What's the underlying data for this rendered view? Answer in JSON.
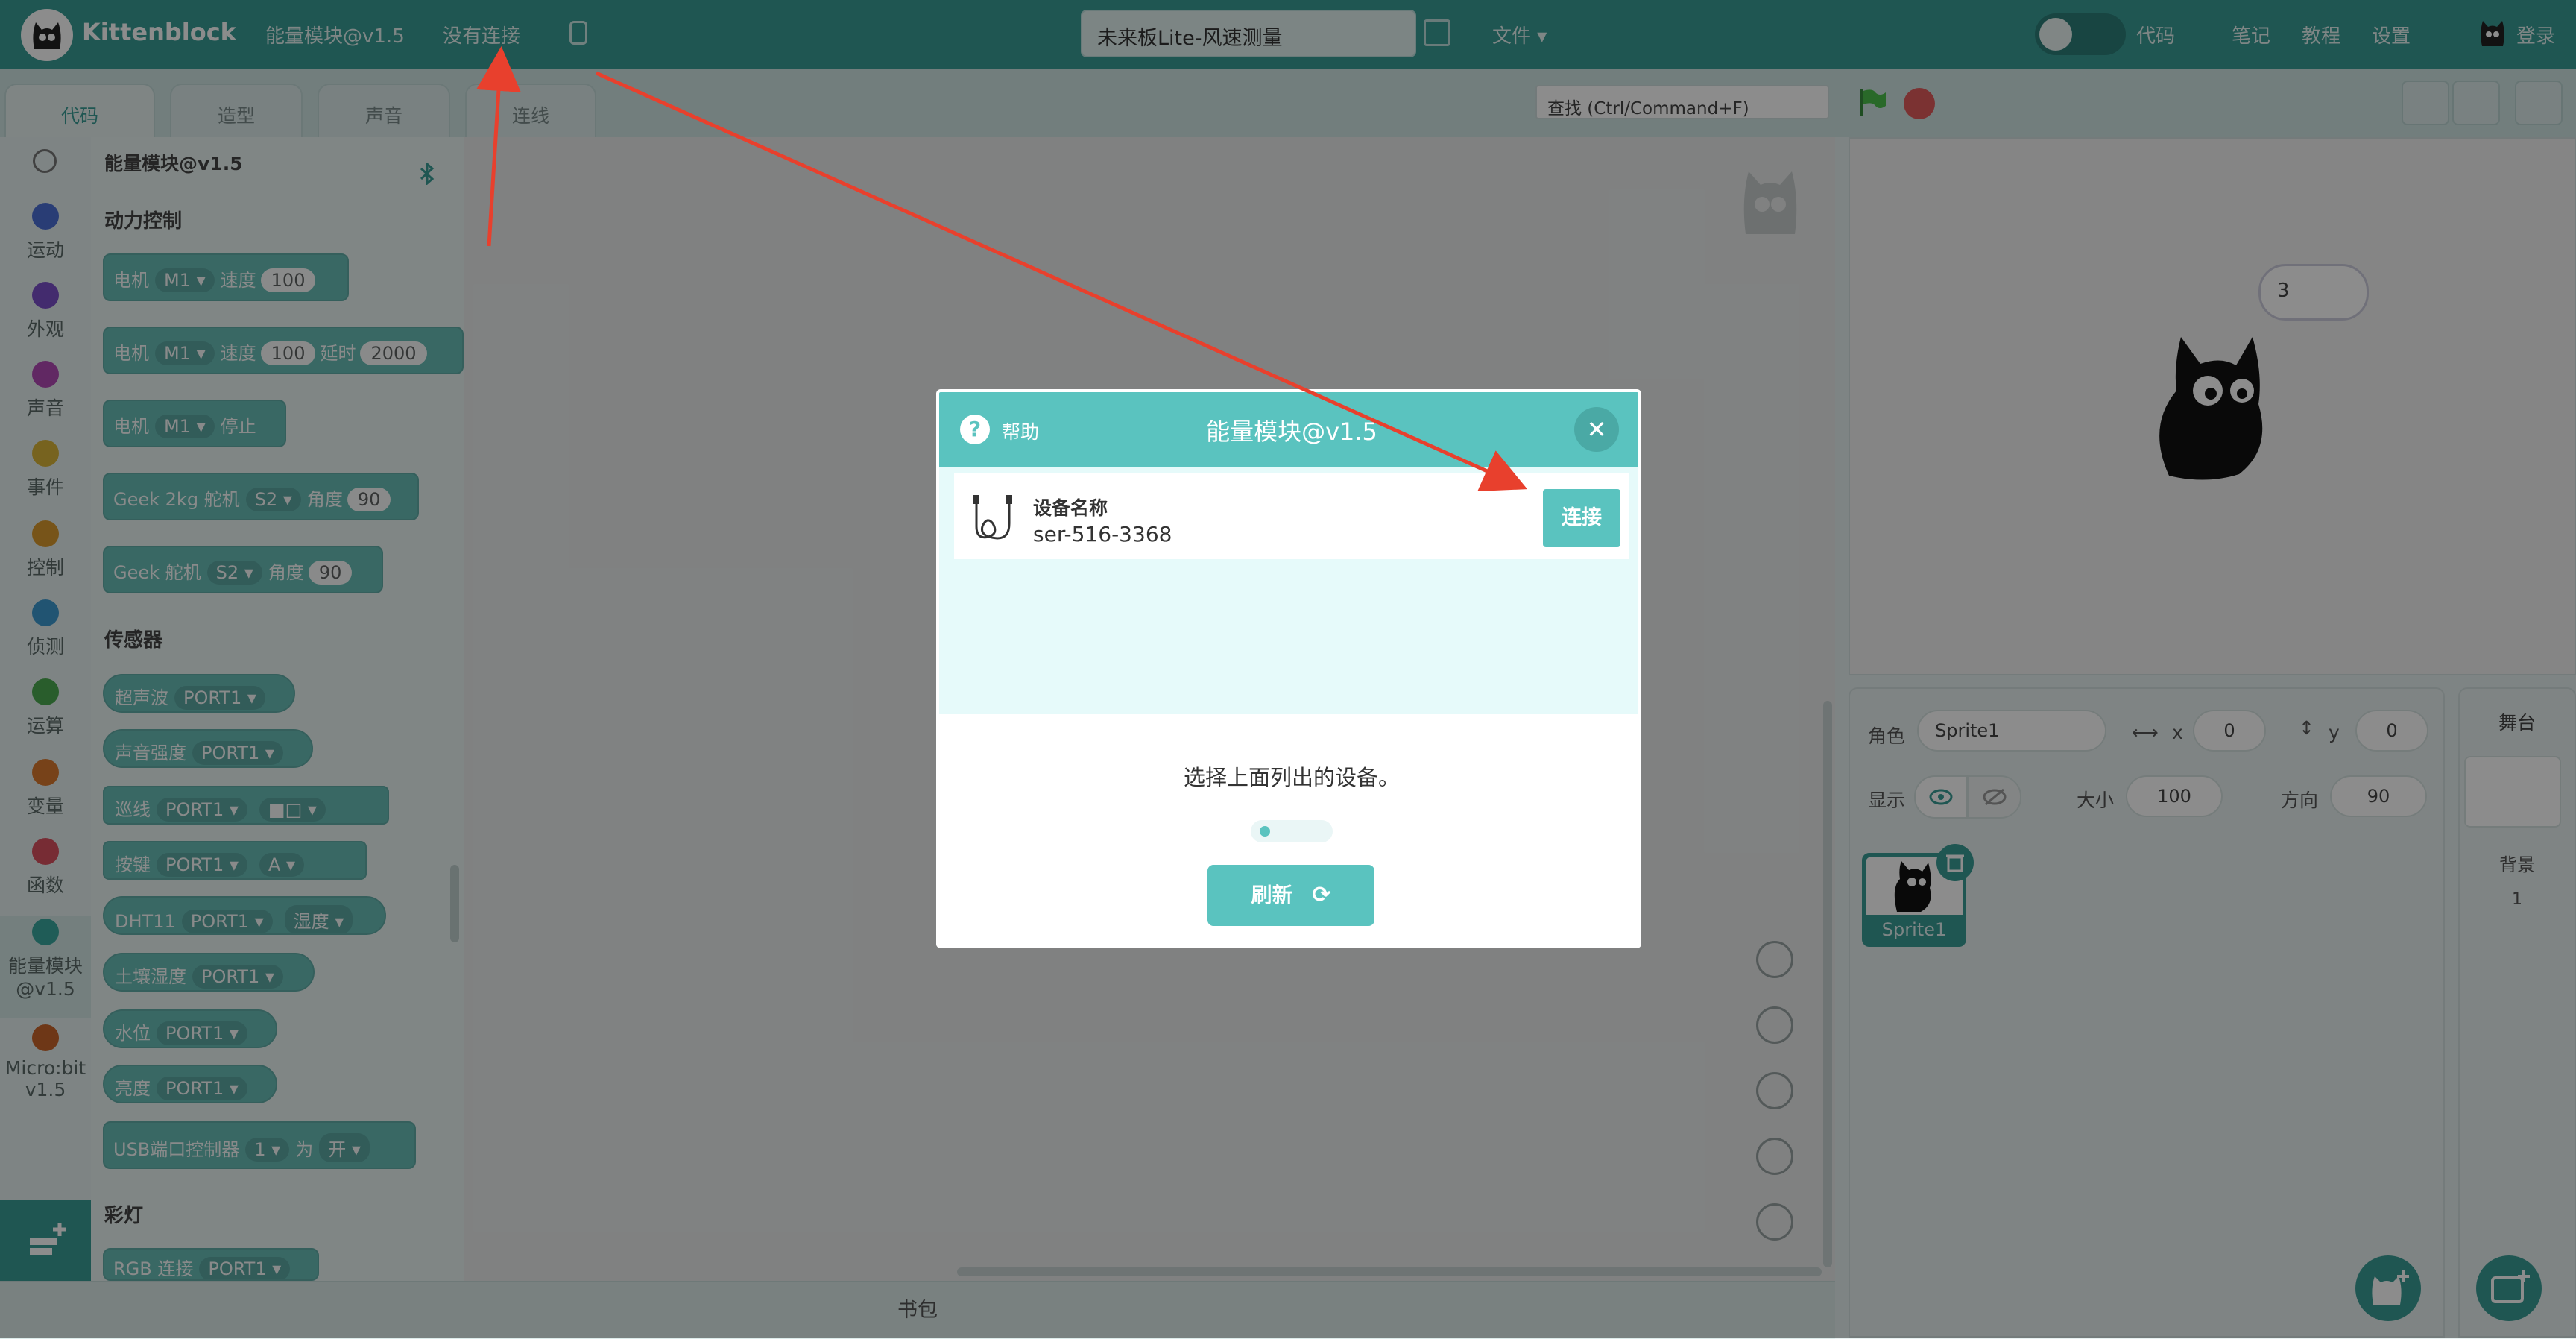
{
  "app": {
    "logo_text": "Kittenblock"
  },
  "menubar": {
    "extension_label": "能量模块@v1.5",
    "connection_status": "没有连接",
    "project_name": "未来板Lite-风速测量",
    "file_menu": "文件 ▾",
    "code_toggle_label": "代码",
    "notes": "笔记",
    "tutorial": "教程",
    "settings": "设置",
    "login": "登录"
  },
  "tabs": [
    {
      "label": "代码"
    },
    {
      "label": "造型"
    },
    {
      "label": "声音"
    },
    {
      "label": "连线"
    }
  ],
  "find": {
    "placeholder": "查找 (Ctrl/Command+F)"
  },
  "categories": [
    {
      "label": "运动",
      "color": "#4c6fd6"
    },
    {
      "label": "外观",
      "color": "#7a4fc8"
    },
    {
      "label": "声音",
      "color": "#b14ab4"
    },
    {
      "label": "事件",
      "color": "#d9b43a"
    },
    {
      "label": "控制",
      "color": "#d99a2e"
    },
    {
      "label": "侦测",
      "color": "#3c9ad0"
    },
    {
      "label": "运算",
      "color": "#4caa50"
    },
    {
      "label": "变量",
      "color": "#d9782e"
    },
    {
      "label": "函数",
      "color": "#d95060"
    },
    {
      "label": "能量模块",
      "label2": "@v1.5",
      "color": "#3aa89f"
    },
    {
      "label": "Micro:bit",
      "label2": "v1.5",
      "color": "#c8642a"
    }
  ],
  "palette": {
    "extension_title": "能量模块@v1.5",
    "section_motor": "动力控制",
    "section_sensor": "传感器",
    "section_light": "彩灯",
    "blocks": {
      "b1": {
        "a": "电机",
        "b": "M1 ▾",
        "c": "速度",
        "d": "100"
      },
      "b2": {
        "a": "电机",
        "b": "M1 ▾",
        "c": "速度",
        "d": "100",
        "e": "延时",
        "f": "2000"
      },
      "b3": {
        "a": "电机",
        "b": "M1 ▾",
        "c": "停止"
      },
      "b4": {
        "a": "Geek 2kg 舵机",
        "b": "S2 ▾",
        "c": "角度",
        "d": "90"
      },
      "b5": {
        "a": "Geek 舵机",
        "b": "S2 ▾",
        "c": "角度",
        "d": "90"
      },
      "s1": {
        "a": "超声波",
        "b": "PORT1 ▾"
      },
      "s2": {
        "a": "声音强度",
        "b": "PORT1 ▾"
      },
      "s3": {
        "a": "巡线",
        "b": "PORT1 ▾",
        "c": "■□ ▾"
      },
      "s4": {
        "a": "按键",
        "b": "PORT1 ▾",
        "c": "A ▾"
      },
      "s5": {
        "a": "DHT11",
        "b": "PORT1 ▾",
        "c": "湿度 ▾"
      },
      "s6": {
        "a": "土壤湿度",
        "b": "PORT1 ▾"
      },
      "s7": {
        "a": "水位",
        "b": "PORT1 ▾"
      },
      "s8": {
        "a": "亮度",
        "b": "PORT1 ▾"
      },
      "s9": {
        "a": "USB端口控制器",
        "b": "1 ▾",
        "c": "为",
        "d": "开 ▾"
      },
      "l1": {
        "a": "RGB 连接",
        "b": "PORT1 ▾"
      }
    }
  },
  "workspace": {
    "backpack": "书包"
  },
  "stage": {
    "speech_bubble": "3"
  },
  "sprite_info": {
    "role_label": "角色",
    "sprite_name": "Sprite1",
    "x_label": "x",
    "x_value": "0",
    "y_label": "y",
    "y_value": "0",
    "show_label": "显示",
    "size_label": "大小",
    "size_value": "100",
    "direction_label": "方向",
    "direction_value": "90",
    "thumbnail_name": "Sprite1"
  },
  "stage_panel": {
    "title": "舞台",
    "backdrop_label": "背景",
    "backdrop_count": "1"
  },
  "modal": {
    "help": "帮助",
    "title": "能量模块@v1.5",
    "device_name_label": "设备名称",
    "device_name": "ser-516-3368",
    "connect": "连接",
    "hint": "选择上面列出的设备。",
    "refresh": "刷新"
  },
  "colors": {
    "accent": "#3a9d96",
    "modal_accent": "#5ac3bf",
    "arrow": "#e8402d"
  }
}
